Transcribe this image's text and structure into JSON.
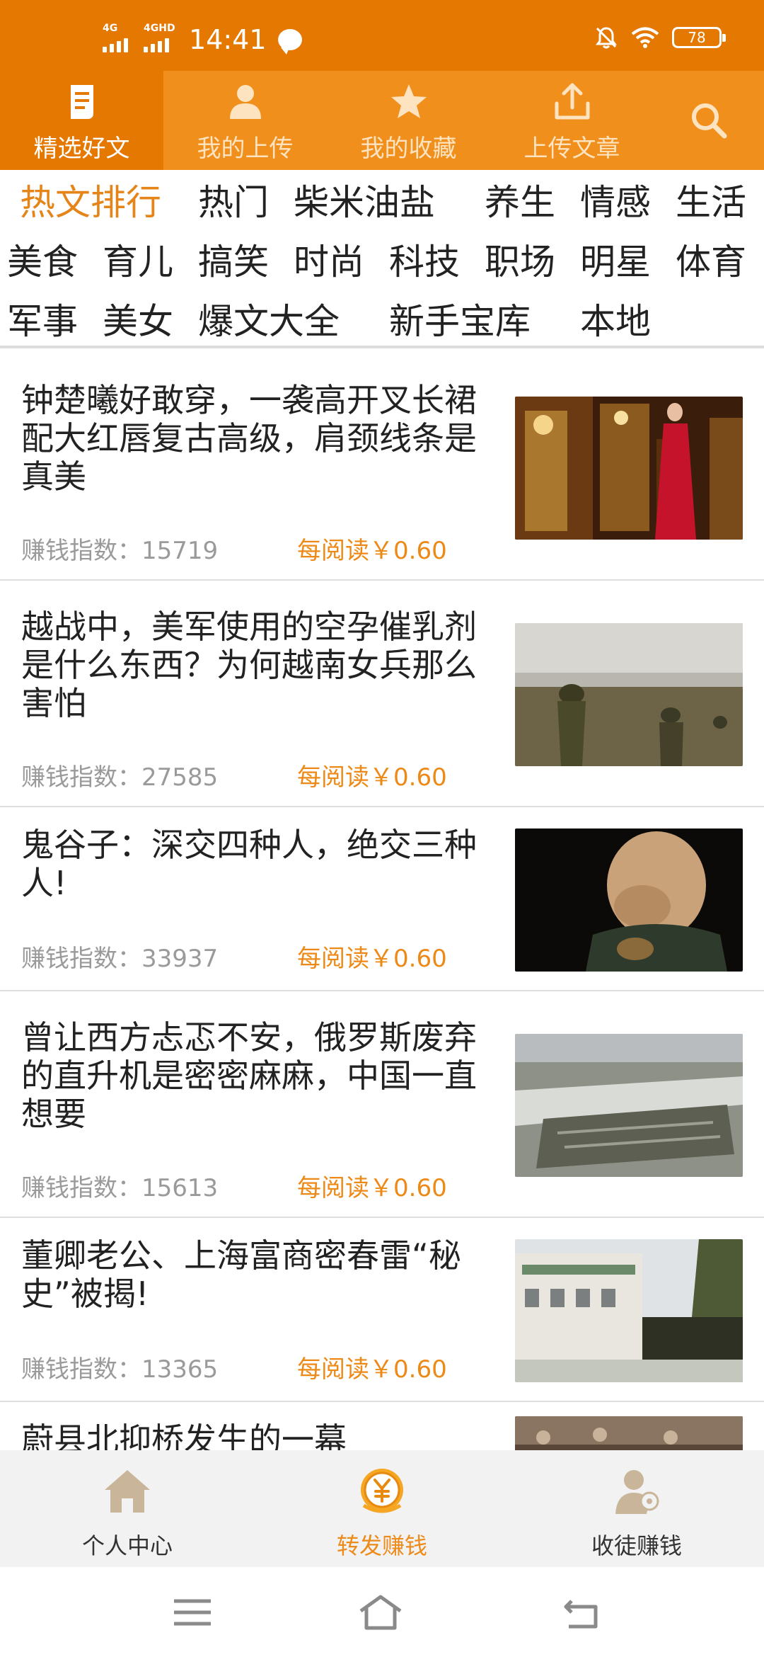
{
  "status_bar": {
    "net1": "4G",
    "net2": "4GHD",
    "time": "14:41",
    "battery": "78"
  },
  "top_tabs": [
    {
      "label": "精选好文",
      "icon": "document-icon"
    },
    {
      "label": "我的上传",
      "icon": "user-icon"
    },
    {
      "label": "我的收藏",
      "icon": "star-icon"
    },
    {
      "label": "上传文章",
      "icon": "upload-icon"
    }
  ],
  "categories": {
    "active": "热文排行",
    "items": [
      "热门",
      "柴米油盐",
      "养生",
      "情感",
      "生活",
      "美食",
      "育儿",
      "搞笑",
      "时尚",
      "科技",
      "职场",
      "明星",
      "体育",
      "军事",
      "美女",
      "爆文大全",
      "新手宝库",
      "本地"
    ]
  },
  "articles": [
    {
      "title": "钟楚曦好敢穿，一袭高开叉长裙配大红唇复古高级，肩颈线条是真美",
      "index_label": "赚钱指数：15719",
      "reward": "每阅读￥0.60"
    },
    {
      "title": "越战中，美军使用的空孕催乳剂是什么东西？为何越南女兵那么害怕",
      "index_label": "赚钱指数：27585",
      "reward": "每阅读￥0.60"
    },
    {
      "title": "鬼谷子：深交四种人，绝交三种人!",
      "index_label": "赚钱指数：33937",
      "reward": "每阅读￥0.60"
    },
    {
      "title": "曾让西方忐忑不安，俄罗斯废弃的直升机是密密麻麻，中国一直想要",
      "index_label": "赚钱指数：15613",
      "reward": "每阅读￥0.60"
    },
    {
      "title": "董卿老公、上海富商密春雷“秘史”被揭!",
      "index_label": "赚钱指数：13365",
      "reward": "每阅读￥0.60"
    },
    {
      "title": "蔚县北抑桥发生的一幕",
      "index_label": "",
      "reward": ""
    }
  ],
  "bottom_nav": [
    {
      "label": "个人中心",
      "icon": "home-icon"
    },
    {
      "label": "转发赚钱",
      "icon": "yuan-coin-icon"
    },
    {
      "label": "收徒赚钱",
      "icon": "person-add-icon"
    }
  ],
  "colors": {
    "brand_orange": "#e57800",
    "tab_orange": "#f18f1c",
    "accent_text": "#e58418"
  }
}
